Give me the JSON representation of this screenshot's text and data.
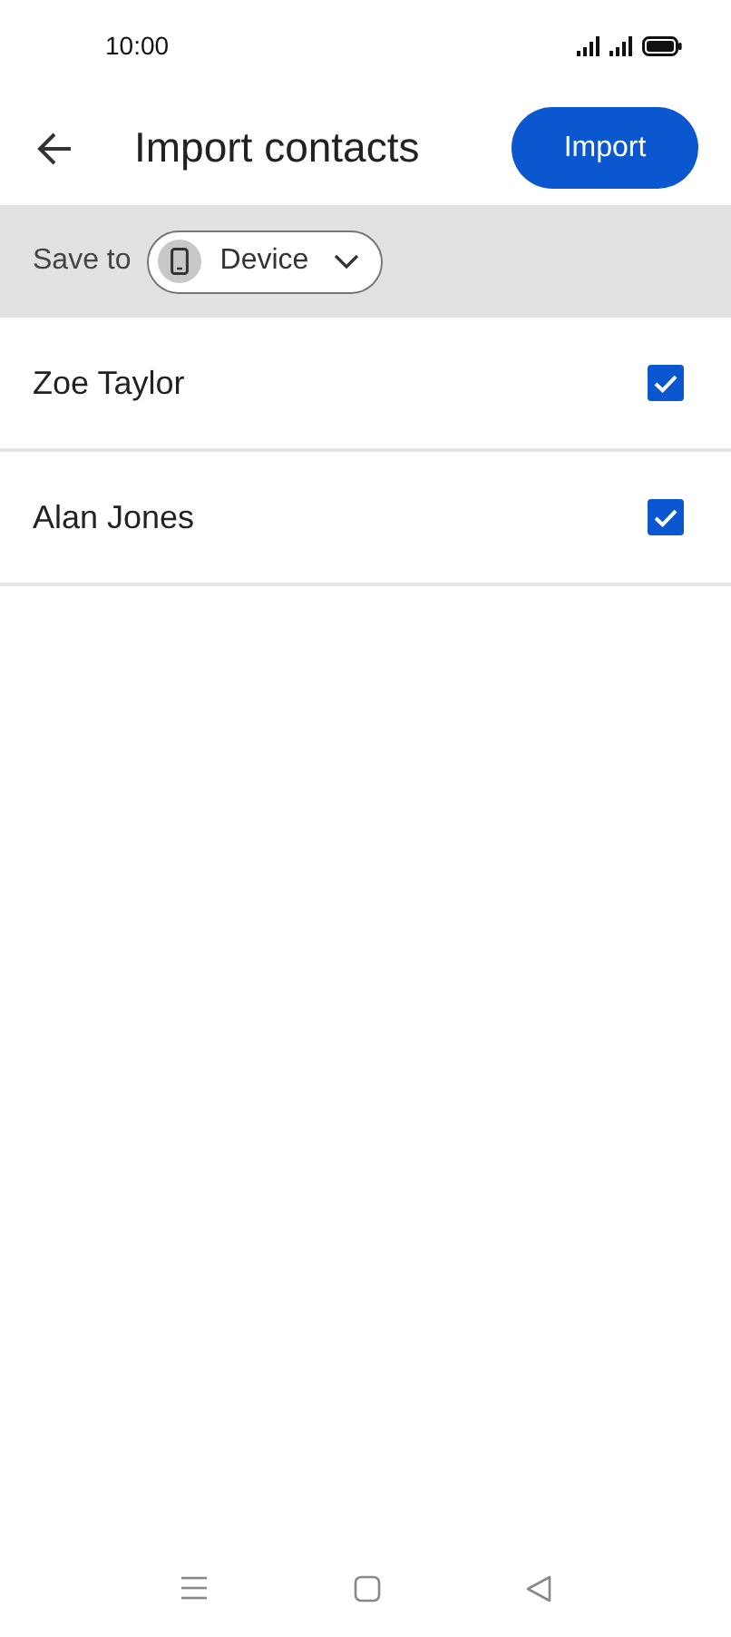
{
  "status_bar": {
    "time": "10:00"
  },
  "app_bar": {
    "title": "Import contacts",
    "action": "Import"
  },
  "save_to": {
    "label": "Save to",
    "value": "Device"
  },
  "contacts": [
    {
      "name": "Zoe Taylor",
      "checked": true
    },
    {
      "name": "Alan Jones",
      "checked": true
    }
  ]
}
